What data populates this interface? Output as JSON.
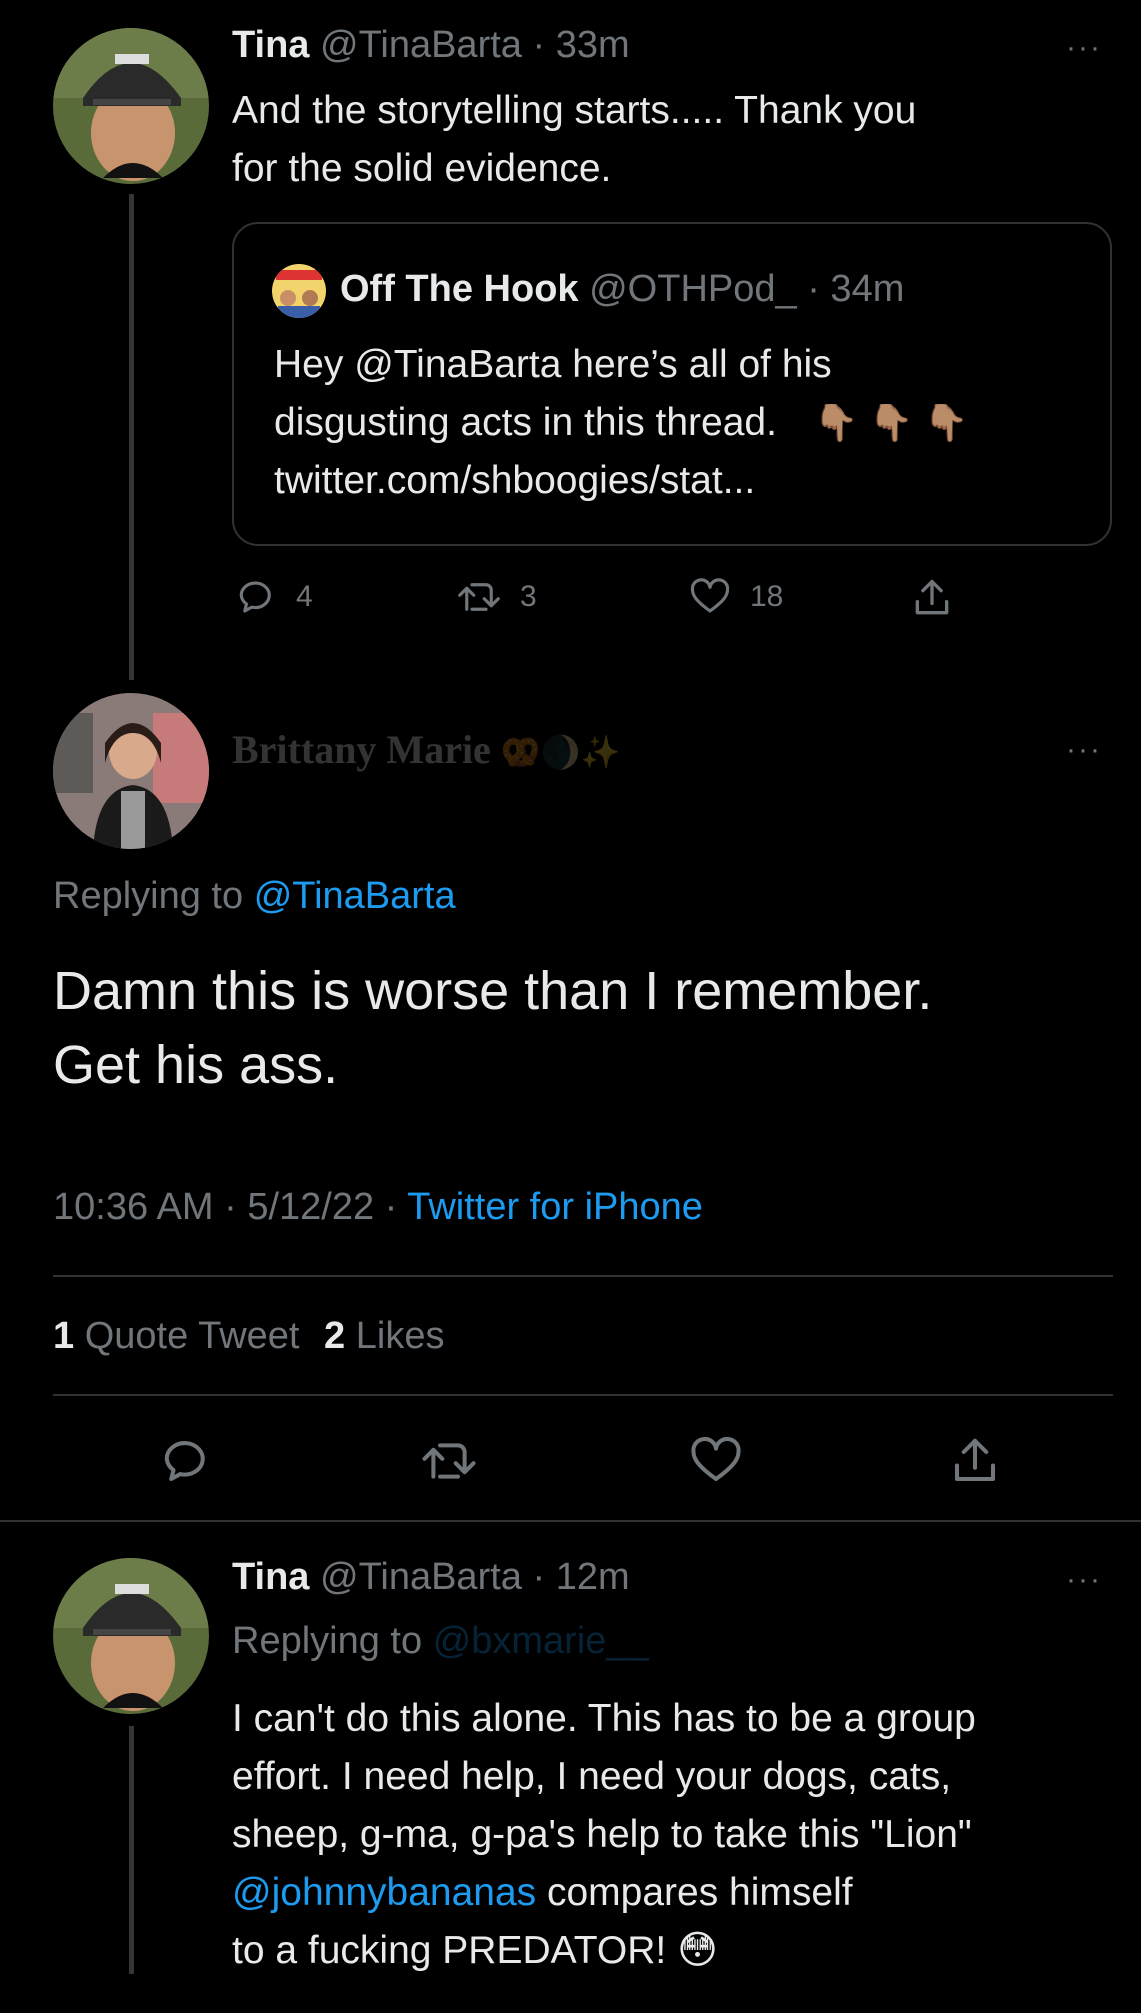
{
  "tweet1": {
    "name": "Tina",
    "handle": "@TinaBarta",
    "time": "· 33m",
    "text_line1": "And the storytelling starts.....  Thank you",
    "text_line2": "for the solid evidence.",
    "quote": {
      "name": "Off The Hook",
      "handle": "@OTHPod_",
      "time": "· 34m",
      "line1": "Hey @TinaBarta here’s all of his",
      "line2": "disgusting acts in this thread.",
      "emoji": "👇🏽 👇🏽 👇🏽",
      "line3": "twitter.com/shboogies/stat..."
    },
    "replies": "4",
    "retweets": "3",
    "likes": "18"
  },
  "tweet2": {
    "name": "Brittany Marie",
    "name_emoji": "🥨🌒✨",
    "replying_label": "Replying to",
    "replying_handle": "@TinaBarta",
    "text_line1": "Damn this is worse than I remember.",
    "text_line2": "Get his ass.",
    "time": "10:36 AM · 5/12/22 ·",
    "source": "Twitter for iPhone",
    "quote_count": "1",
    "quote_label": "Quote Tweet",
    "likes_count": "2",
    "likes_label": "Likes"
  },
  "tweet3": {
    "name": "Tina",
    "handle": "@TinaBarta",
    "time": "· 12m",
    "replying_label": "Replying to",
    "replying_handle": "@bxmarie__",
    "line1": "I can't do this alone.  This has to be a group",
    "line2": "effort.  I need help, I need your dogs, cats,",
    "line3": "sheep, g-ma, g-pa's help to take this \"Lion\"",
    "line4_mention": "@johnnybananas",
    "line4_rest": " compares himself",
    "line5": "to a fucking PREDATOR!",
    "line5_emoji": "😳"
  },
  "more_icon": "···",
  "colors": {
    "background": "#000000",
    "text": "#e7e9ea",
    "muted": "#71767b",
    "link": "#1d9bf0",
    "border": "#2f3336"
  }
}
